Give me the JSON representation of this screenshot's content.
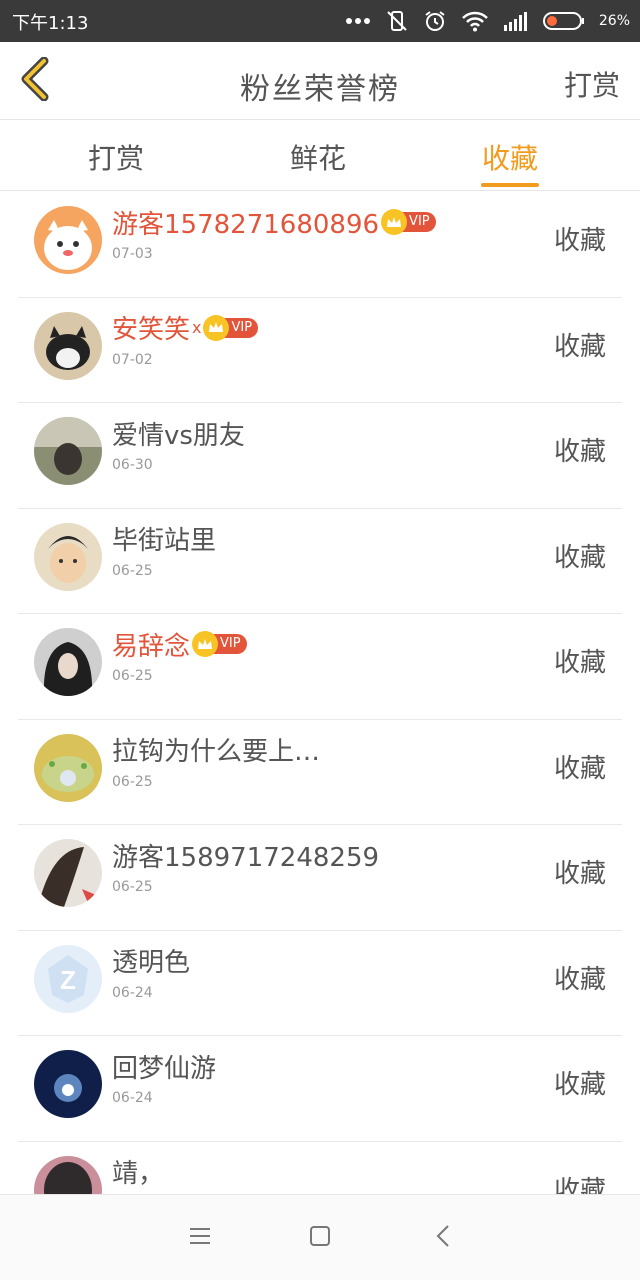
{
  "status_bar": {
    "time": "下午1:13",
    "battery": "26%"
  },
  "header": {
    "title": "粉丝荣誉榜",
    "action_label": "打赏"
  },
  "tabs": [
    {
      "label": "打赏",
      "active": false
    },
    {
      "label": "鲜花",
      "active": false
    },
    {
      "label": "收藏",
      "active": true
    }
  ],
  "vip_label": "VIP",
  "accent_color": "#f29c1f",
  "vip_name_color": "#e2553b",
  "list": [
    {
      "name": "游客1578271680896",
      "suffix": "",
      "vip": true,
      "date": "07-03",
      "action": "收藏"
    },
    {
      "name": "安笑笑",
      "suffix": "x",
      "vip": true,
      "date": "07-02",
      "action": "收藏"
    },
    {
      "name": "爱情vs朋友",
      "suffix": "",
      "vip": false,
      "date": "06-30",
      "action": "收藏"
    },
    {
      "name": "毕街站里",
      "suffix": "",
      "vip": false,
      "date": "06-25",
      "action": "收藏"
    },
    {
      "name": "易辞念",
      "suffix": "",
      "vip": true,
      "date": "06-25",
      "action": "收藏"
    },
    {
      "name": "拉钩为什么要上…",
      "suffix": "",
      "vip": false,
      "date": "06-25",
      "action": "收藏"
    },
    {
      "name": "游客1589717248259",
      "suffix": "",
      "vip": false,
      "date": "06-25",
      "action": "收藏"
    },
    {
      "name": "透明色",
      "suffix": "",
      "vip": false,
      "date": "06-24",
      "action": "收藏"
    },
    {
      "name": "回梦仙游",
      "suffix": "",
      "vip": false,
      "date": "06-24",
      "action": "收藏"
    },
    {
      "name": "靖，",
      "suffix": "",
      "vip": false,
      "date": "",
      "action": "收藏"
    }
  ]
}
